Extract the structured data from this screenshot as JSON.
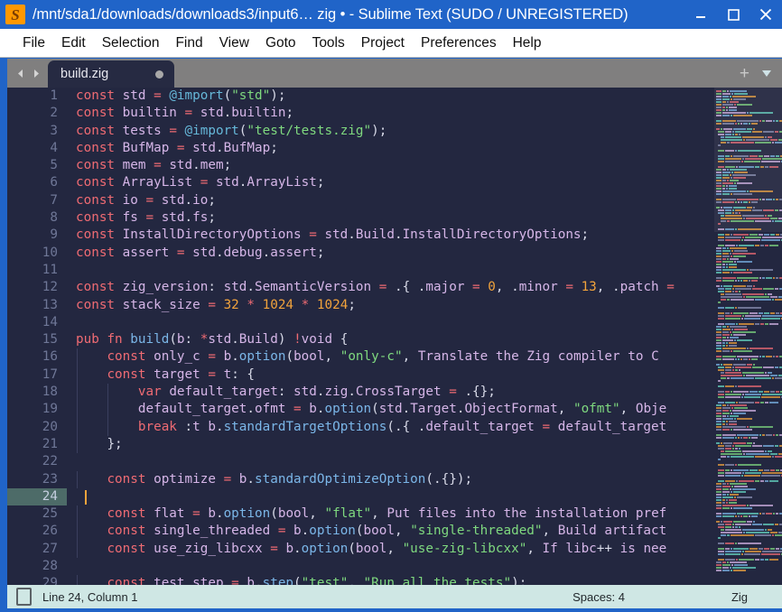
{
  "window": {
    "title": "/mnt/sda1/downloads/downloads3/input6… zig • - Sublime Text (SUDO / UNREGISTERED)",
    "app_icon_glyph": "S",
    "minimize_label": "Minimize",
    "maximize_label": "Maximize",
    "close_label": "Close",
    "accent_color": "#2064c8"
  },
  "menu": {
    "items": [
      {
        "label": "File"
      },
      {
        "label": "Edit"
      },
      {
        "label": "Selection"
      },
      {
        "label": "Find"
      },
      {
        "label": "View"
      },
      {
        "label": "Goto"
      },
      {
        "label": "Tools"
      },
      {
        "label": "Project"
      },
      {
        "label": "Preferences"
      },
      {
        "label": "Help"
      }
    ]
  },
  "tabbar": {
    "prev_label": "◀",
    "next_label": "▶",
    "new_tab_label": "+",
    "menu_label": "▾",
    "tabs": [
      {
        "label": "build.zig",
        "dirty": true,
        "active": true
      }
    ]
  },
  "editor": {
    "background": "#232740",
    "active_line_gutter_color": "#4d6b68",
    "cursor_color": "#f2a33c",
    "first_visible_line": 1,
    "lines": [
      {
        "n": 1,
        "text": "const std = @import(\"std\");"
      },
      {
        "n": 2,
        "text": "const builtin = std.builtin;"
      },
      {
        "n": 3,
        "text": "const tests = @import(\"test/tests.zig\");"
      },
      {
        "n": 4,
        "text": "const BufMap = std.BufMap;"
      },
      {
        "n": 5,
        "text": "const mem = std.mem;"
      },
      {
        "n": 6,
        "text": "const ArrayList = std.ArrayList;"
      },
      {
        "n": 7,
        "text": "const io = std.io;"
      },
      {
        "n": 8,
        "text": "const fs = std.fs;"
      },
      {
        "n": 9,
        "text": "const InstallDirectoryOptions = std.Build.InstallDirectoryOptions;"
      },
      {
        "n": 10,
        "text": "const assert = std.debug.assert;"
      },
      {
        "n": 11,
        "text": ""
      },
      {
        "n": 12,
        "text": "const zig_version: std.SemanticVersion = .{ .major = 0, .minor = 13, .patch = "
      },
      {
        "n": 13,
        "text": "const stack_size = 32 * 1024 * 1024;"
      },
      {
        "n": 14,
        "text": ""
      },
      {
        "n": 15,
        "text": "pub fn build(b: *std.Build) !void {"
      },
      {
        "n": 16,
        "text": "    const only_c = b.option(bool, \"only-c\", \"Translate the Zig compiler to C "
      },
      {
        "n": 17,
        "text": "    const target = t: {"
      },
      {
        "n": 18,
        "text": "        var default_target: std.zig.CrossTarget = .{};"
      },
      {
        "n": 19,
        "text": "        default_target.ofmt = b.option(std.Target.ObjectFormat, \"ofmt\", \"Obje"
      },
      {
        "n": 20,
        "text": "        break :t b.standardTargetOptions(.{ .default_target = default_target "
      },
      {
        "n": 21,
        "text": "    };"
      },
      {
        "n": 22,
        "text": ""
      },
      {
        "n": 23,
        "text": "    const optimize = b.standardOptimizeOption(.{});"
      },
      {
        "n": 24,
        "text": "",
        "active": true
      },
      {
        "n": 25,
        "text": "    const flat = b.option(bool, \"flat\", \"Put files into the installation pref"
      },
      {
        "n": 26,
        "text": "    const single_threaded = b.option(bool, \"single-threaded\", \"Build artifact"
      },
      {
        "n": 27,
        "text": "    const use_zig_libcxx = b.option(bool, \"use-zig-libcxx\", \"If libc++ is nee"
      },
      {
        "n": 28,
        "text": ""
      },
      {
        "n": 29,
        "text": "    const test_step = b.step(\"test\", \"Run all the tests\");"
      }
    ]
  },
  "statusbar": {
    "position": "Line 24, Column 1",
    "indentation": "Spaces: 4",
    "syntax": "Zig",
    "encoding_icon": "document-icon"
  }
}
